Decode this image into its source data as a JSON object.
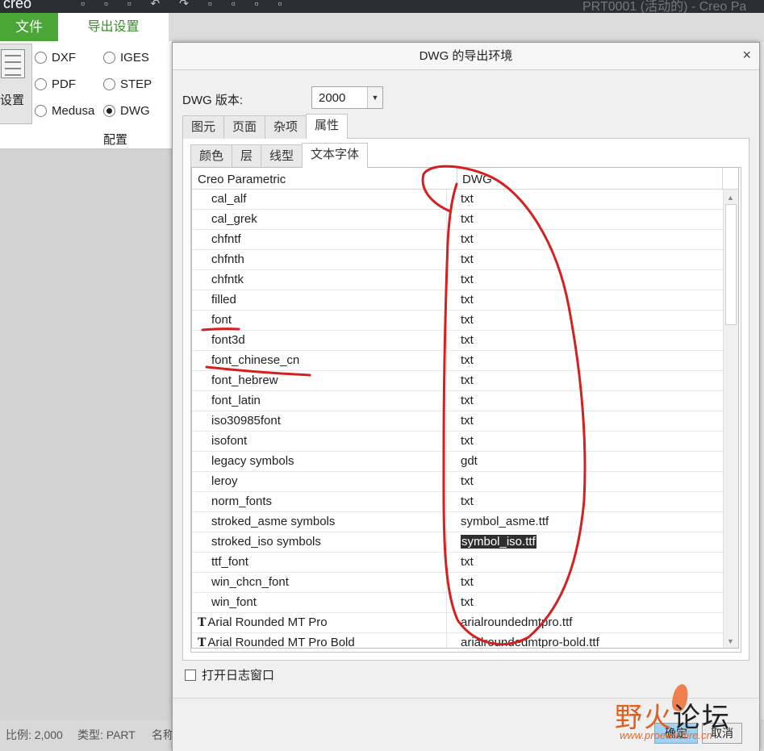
{
  "app": {
    "logo": "creo",
    "quick_access_icons": "▫ ▫ ▫ ↶ ↷ ▫ ▫ ▫ ▫",
    "window_title": "PRT0001 (活动的) - Creo Pa"
  },
  "ribbon": {
    "file_tab": "文件",
    "export_tab": "导出设置",
    "settings_label": "设置",
    "formats": [
      {
        "label": "DXF",
        "selected": false
      },
      {
        "label": "IGES",
        "selected": false
      },
      {
        "label": "PDF",
        "selected": false
      },
      {
        "label": "STEP",
        "selected": false
      },
      {
        "label": "Medusa",
        "selected": false
      },
      {
        "label": "DWG",
        "selected": true
      }
    ],
    "group_label": "配置"
  },
  "status": {
    "scale": "比例: 2,000",
    "type": "类型: PART",
    "name": "名称"
  },
  "dialog": {
    "title": "DWG 的导出环境",
    "close": "×",
    "version_label": "DWG 版本:",
    "version_value": "2000",
    "outer_tabs": [
      "图元",
      "页面",
      "杂项",
      "属性"
    ],
    "inner_tabs": [
      "颜色",
      "层",
      "线型",
      "文本字体"
    ],
    "table": {
      "col1": "Creo Parametric",
      "col2": "DWG",
      "rows": [
        {
          "font": "cal_alf",
          "dwg": "txt"
        },
        {
          "font": "cal_grek",
          "dwg": "txt"
        },
        {
          "font": "chfntf",
          "dwg": "txt"
        },
        {
          "font": "chfnth",
          "dwg": "txt"
        },
        {
          "font": "chfntk",
          "dwg": "txt"
        },
        {
          "font": "filled",
          "dwg": "txt"
        },
        {
          "font": "font",
          "dwg": "txt"
        },
        {
          "font": "font3d",
          "dwg": "txt"
        },
        {
          "font": "font_chinese_cn",
          "dwg": "txt"
        },
        {
          "font": "font_hebrew",
          "dwg": "txt"
        },
        {
          "font": "font_latin",
          "dwg": "txt"
        },
        {
          "font": "iso30985font",
          "dwg": "txt"
        },
        {
          "font": "isofont",
          "dwg": "txt"
        },
        {
          "font": "legacy symbols",
          "dwg": "gdt"
        },
        {
          "font": "leroy",
          "dwg": "txt"
        },
        {
          "font": "norm_fonts",
          "dwg": "txt"
        },
        {
          "font": "stroked_asme symbols",
          "dwg": "symbol_asme.ttf"
        },
        {
          "font": "stroked_iso symbols",
          "dwg": "symbol_iso.ttf"
        },
        {
          "font": "ttf_font",
          "dwg": "txt"
        },
        {
          "font": "win_chcn_font",
          "dwg": "txt"
        },
        {
          "font": "win_font",
          "dwg": "txt"
        },
        {
          "font": "Arial Rounded MT Pro",
          "dwg": "arialroundedmtpro.ttf"
        },
        {
          "font": "Arial Rounded MT Pro Bold",
          "dwg": "arialroundedmtpro-bold.ttf"
        }
      ]
    },
    "log_checkbox": "打开日志窗口",
    "ok": "确定",
    "cancel": "取消"
  },
  "watermark": {
    "text1": "野火",
    "text2": "论坛",
    "url": "www.proewildfire.cn"
  },
  "colors": {
    "file_tab": "#4aa637",
    "annotation": "#d42020",
    "ok_button": "#9fd2f5"
  }
}
